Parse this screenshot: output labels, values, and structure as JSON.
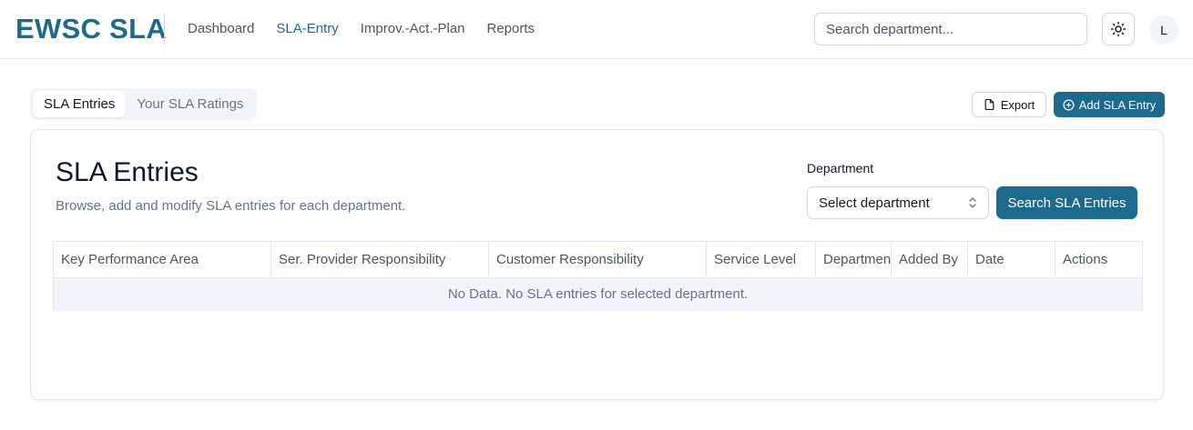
{
  "app": {
    "brand": "EWSC SLA"
  },
  "nav": {
    "items": [
      {
        "label": "Dashboard",
        "active": false
      },
      {
        "label": "SLA-Entry",
        "active": true
      },
      {
        "label": "Improv.-Act.-Plan",
        "active": false
      },
      {
        "label": "Reports",
        "active": false
      }
    ]
  },
  "header": {
    "search_placeholder": "Search department...",
    "theme_icon": "sun-icon",
    "avatar_initial": "L"
  },
  "tabs": [
    {
      "label": "SLA Entries",
      "active": true
    },
    {
      "label": "Your SLA Ratings",
      "active": false
    }
  ],
  "actions": {
    "export_label": "Export",
    "add_label": "Add SLA Entry"
  },
  "card": {
    "title": "SLA Entries",
    "description": "Browse, add and modify SLA entries for each department.",
    "department_label": "Department",
    "department_select": "Select department",
    "search_button": "Search SLA Entries"
  },
  "table": {
    "columns": [
      "Key Performance Area",
      "Ser. Provider Responsibility",
      "Customer Responsibility",
      "Service Level",
      "Department",
      "Added By",
      "Date",
      "Actions"
    ],
    "empty_message": "No Data. No SLA entries for selected department."
  },
  "colors": {
    "brand": "#1d6a8e",
    "border": "#e5e7eb",
    "muted_text": "#64748b"
  }
}
